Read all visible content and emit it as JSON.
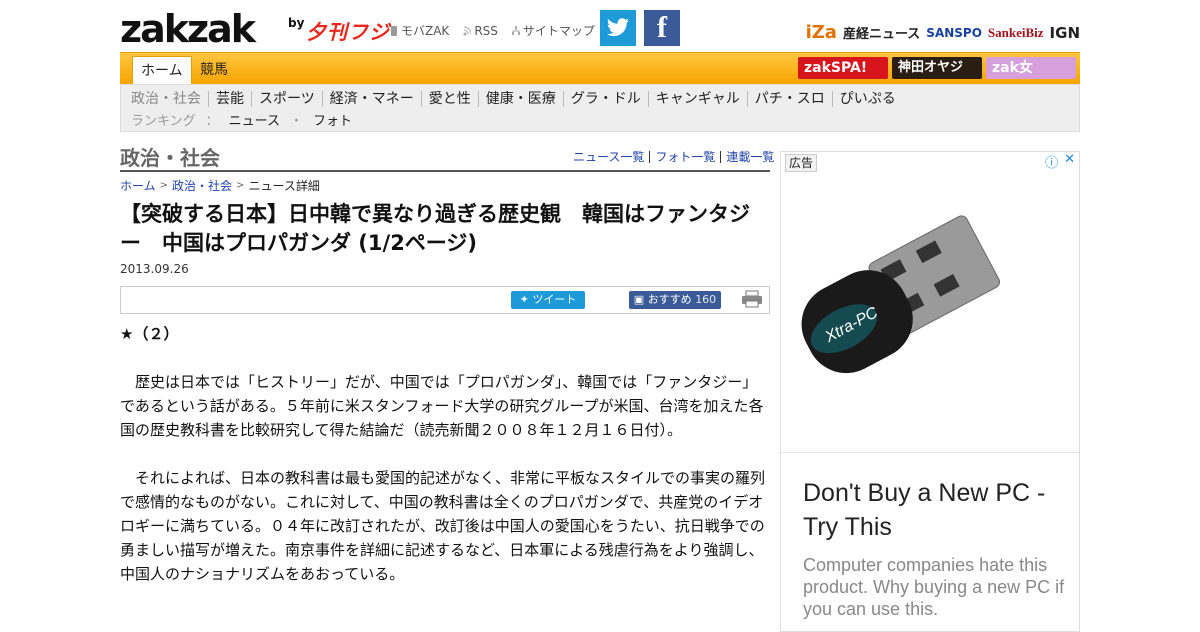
{
  "header": {
    "logo": "zakzak",
    "logo_by": "by",
    "logo_fuji": "夕刊フジ",
    "links": [
      "モバZAK",
      "RSS",
      "サイトマップ"
    ],
    "social": {
      "twitter": "t",
      "facebook": "f"
    },
    "partners": [
      "iZa",
      "産経ニュース",
      "SANSPO",
      "SankeiBiz",
      "IGN"
    ]
  },
  "nav": {
    "tabs": [
      "ホーム",
      "競馬"
    ],
    "right_buttons": [
      "zakSPA!",
      "神田オヤジ",
      "zak女"
    ]
  },
  "subnav": {
    "categories": [
      "政治・社会",
      "芸能",
      "スポーツ",
      "経済・マネー",
      "愛と性",
      "健康・医療",
      "グラ・ドル",
      "キャンギャル",
      "パチ・スロ",
      "ぴいぷる"
    ],
    "ranking_label": "ランキング",
    "ranking_sep": "：",
    "ranking_links": [
      "ニュース",
      "フォト"
    ],
    "ranking_dot": "・"
  },
  "section": {
    "title": "政治・社会",
    "links": [
      "ニュース一覧",
      "フォト一覧",
      "連載一覧"
    ]
  },
  "breadcrumb": [
    "ホーム",
    "政治・社会",
    "ニュース詳細"
  ],
  "article": {
    "headline": "【突破する日本】日中韓で異なり過ぎる歴史観　韓国はファンタジー　中国はプロパガンダ (1/2ページ)",
    "date": "2013.09.26",
    "tweet_label": "ツイート",
    "recommend_label": "おすすめ",
    "recommend_count": "160",
    "paragraphs": [
      "★（２）",
      "　歴史は日本では「ヒストリー」だが、中国では「プロパガンダ」、韓国では「ファンタジー」であるという話がある。５年前に米スタンフォード大学の研究グループが米国、台湾を加えた各国の歴史教科書を比較研究して得た結論だ（読売新聞２００８年１２月１６日付）。",
      "　それによれば、日本の教科書は最も愛国的記述がなく、非常に平板なスタイルでの事実の羅列で感情的なものがない。これに対して、中国の教科書は全くのプロパガンダで、共産党のイデオロギーに満ちている。０４年に改訂されたが、改訂後は中国人の愛国心をうたい、抗日戦争での勇ましい描写が増えた。南京事件を詳細に記述するなど、日本軍による残虐行為をより強調し、中国人のナショナリズムをあおっている。"
    ]
  },
  "ad": {
    "tag": "広告",
    "product_label": "Xtra-PC",
    "title": "Don't Buy a New PC - Try This",
    "text": "Computer companies hate this product. Why buying a new PC if you can use this."
  },
  "colors": {
    "nav_orange": "#f8a400",
    "link_blue": "#2244aa",
    "twitter": "#1c9bd8",
    "facebook": "#3b5b98",
    "fuji_red": "#e8261c"
  }
}
